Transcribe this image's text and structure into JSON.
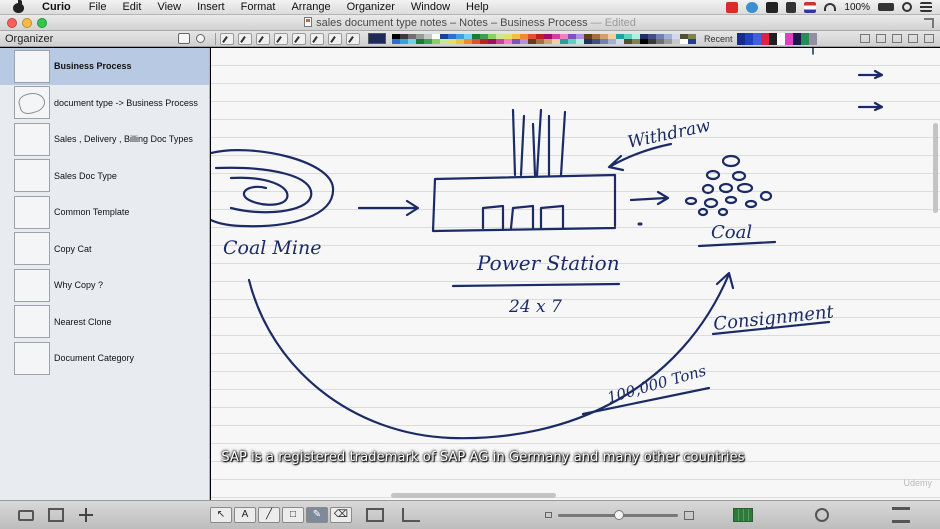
{
  "menubar": {
    "app_name": "Curio",
    "items": [
      "File",
      "Edit",
      "View",
      "Insert",
      "Format",
      "Arrange",
      "Organizer",
      "Window",
      "Help"
    ],
    "battery": "100%"
  },
  "window": {
    "title": "sales document type notes – Notes – Business Process",
    "edited": "— Edited"
  },
  "toolbar": {
    "organizer_title": "Organizer",
    "recent_label": "Recent",
    "current_color": "#1e2a5a",
    "palette": [
      "#000000",
      "#3a3a3a",
      "#707070",
      "#9a9a9a",
      "#c8c8c8",
      "#ffffff",
      "#1f3f8f",
      "#2f6fcf",
      "#3aa0e0",
      "#6fd0f0",
      "#1a7a3a",
      "#3aa050",
      "#8ad060",
      "#c8e890",
      "#e0e070",
      "#f0c040",
      "#f08a30",
      "#e05030",
      "#c02020",
      "#a01060",
      "#d040a0",
      "#f080c0",
      "#8050c0",
      "#b090e0",
      "#604020",
      "#a07040",
      "#d0a070",
      "#f0d0a0",
      "#20a0a0",
      "#60d0c0",
      "#b0f0e0",
      "#203060",
      "#405080",
      "#7080b0",
      "#a0b0d0",
      "#d0d8f0",
      "#505030",
      "#808050"
    ],
    "recent_colors": [
      "#1a2a8a",
      "#2040c0",
      "#4060e0",
      "#e02040",
      "#202020",
      "#ffffff",
      "#e040c0",
      "#1a1a4a",
      "#2a8a5a",
      "#9090a0"
    ]
  },
  "organizer": {
    "items": [
      {
        "label": "Business Process",
        "selected": true
      },
      {
        "label": "document type -> Business Process",
        "selected": false
      },
      {
        "label": "Sales , Delivery , Billing Doc Types",
        "selected": false
      },
      {
        "label": "Sales Doc Type",
        "selected": false
      },
      {
        "label": "Common Template",
        "selected": false
      },
      {
        "label": "Copy Cat",
        "selected": false
      },
      {
        "label": "Why Copy ?",
        "selected": false
      },
      {
        "label": "Nearest Clone",
        "selected": false
      },
      {
        "label": "Document Category",
        "selected": false
      }
    ]
  },
  "canvas": {
    "handwriting": {
      "coal_mine": "Coal Mine",
      "power_station": "Power Station",
      "capacity": "24 x 7",
      "withdraw": "Withdraw",
      "coal": "Coal",
      "consignment": "Consignment",
      "tons": "100,000 Tons"
    },
    "caption": "SAP is a registered trademark of SAP AG in Germany and many other countries",
    "watermark": "Udemy"
  },
  "bottombar": {
    "tools": [
      "↖",
      "A",
      "╱",
      "□",
      "✎",
      "⌫"
    ]
  }
}
